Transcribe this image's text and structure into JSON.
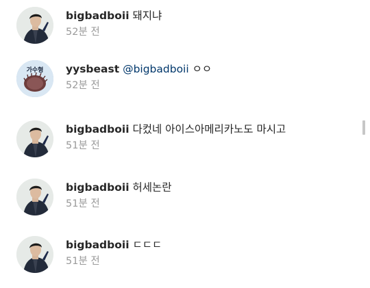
{
  "comments": [
    {
      "avatar_icon": "profile-photo-man-icon",
      "username": "bigbadboii",
      "mention": "",
      "text": "돼지냐",
      "time": "52분 전"
    },
    {
      "avatar_icon": "profile-photo-hedgehog-icon",
      "avatar_caption": "가수형",
      "username": "yysbeast",
      "mention": "@bigbadboii",
      "text": "ㅇㅇ",
      "time": "52분 전"
    },
    {
      "avatar_icon": "profile-photo-man-icon",
      "username": "bigbadboii",
      "mention": "",
      "text": "다컸네 아이스아메리카노도 마시고",
      "time": "51분 전"
    },
    {
      "avatar_icon": "profile-photo-man-icon",
      "username": "bigbadboii",
      "mention": "",
      "text": "허세논란",
      "time": "51분 전"
    },
    {
      "avatar_icon": "profile-photo-man-icon",
      "username": "bigbadboii",
      "mention": "",
      "text": "ㄷㄷㄷ",
      "time": "51분 전"
    }
  ],
  "colors": {
    "username": "#262626",
    "mention": "#00376b",
    "timestamp": "#9a9a9a",
    "background": "#ffffff"
  }
}
